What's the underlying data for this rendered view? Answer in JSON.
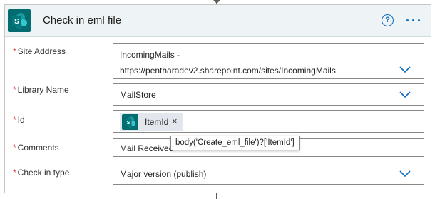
{
  "card": {
    "title": "Check in eml file",
    "icon": "sharepoint-icon",
    "help_icon": "?",
    "more_icon": "ellipsis-icon"
  },
  "fields": {
    "site_address": {
      "label": "Site Address",
      "required": "*",
      "value_line1": "IncomingMails -",
      "value_line2": "https://pentharadev2.sharepoint.com/sites/IncomingMails"
    },
    "library_name": {
      "label": "Library Name",
      "required": "*",
      "value": "MailStore"
    },
    "id": {
      "label": "Id",
      "required": "*",
      "token_label": "ItemId",
      "token_remove": "×"
    },
    "comments": {
      "label": "Comments",
      "required": "*",
      "value": "Mail Received"
    },
    "check_in_type": {
      "label": "Check in type",
      "required": "*",
      "value": "Major version (publish)"
    }
  },
  "tooltip": {
    "text": "body('Create_eml_file')?['ItemId']"
  },
  "colors": {
    "accent": "#0f6cbd",
    "sharepoint": "#036c70",
    "required": "#d13438",
    "header_bg": "#eef3f5",
    "token_bg": "#e1e7ec"
  }
}
